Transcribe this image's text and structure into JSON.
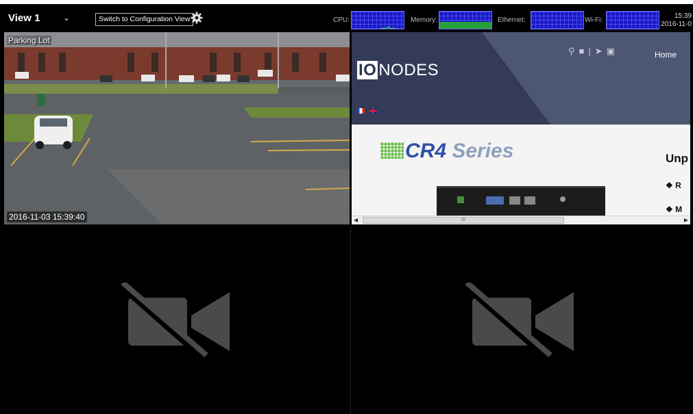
{
  "header": {
    "view_title": "View 1",
    "switch_button_label": "Switch to Configuration View",
    "monitors": [
      {
        "label": "CPU:"
      },
      {
        "label": "Memory:"
      },
      {
        "label": "Ethernet:"
      },
      {
        "label": "Wi-Fi:"
      }
    ],
    "clock": {
      "time": "15:39",
      "date": "2016-11-0"
    }
  },
  "tiles": {
    "camera": {
      "label": "Parking Lot",
      "timestamp": "2016-11-03 15:39:40"
    },
    "web": {
      "logo_box": "IO",
      "logo_text": "NODES",
      "nav_home": "Home",
      "product_cr": "CR4",
      "product_series": " Series",
      "heading": "Unp",
      "bullet_1": "❖ R",
      "bullet_2": "❖ M",
      "scroll_thumb": "III"
    },
    "empty_3": {
      "icon": "camera-off-icon"
    },
    "empty_4": {
      "icon": "camera-off-icon"
    }
  },
  "colors": {
    "graph_bg": "#1818c8",
    "memory_fill": "#27a23a",
    "nocam_icon": "#4a4a4a"
  }
}
